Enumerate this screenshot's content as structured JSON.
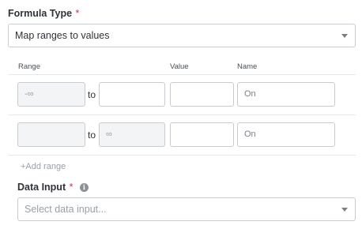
{
  "formula_type": {
    "label": "Formula Type",
    "required_mark": "*",
    "selected": "Map ranges to values"
  },
  "ranges": {
    "headers": {
      "range": "Range",
      "value": "Value",
      "name": "Name"
    },
    "connector": "to",
    "rows": [
      {
        "from": "-∞",
        "from_disabled": true,
        "to": "",
        "to_disabled": false,
        "value": "",
        "name_placeholder": "On"
      },
      {
        "from": "",
        "from_disabled": true,
        "to": "∞",
        "to_disabled": true,
        "value": "",
        "name_placeholder": "On"
      }
    ],
    "add_label": "+Add range"
  },
  "data_input": {
    "label": "Data Input",
    "required_mark": "*",
    "info_icon": "info-icon",
    "info_glyph": "i",
    "placeholder": "Select data input..."
  }
}
